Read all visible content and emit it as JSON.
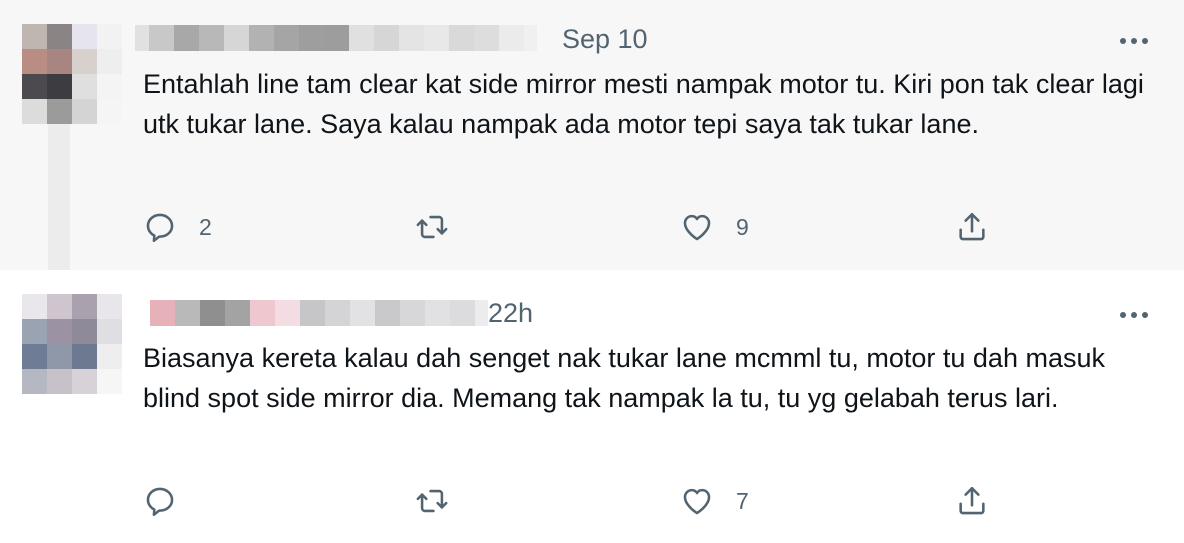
{
  "tweets": [
    {
      "time": "Sep 10",
      "text": "Entahlah line tam clear kat side mirror mesti nampak motor tu. Kiri pon tak clear lagi utk tukar lane. Saya kalau nampak ada motor tepi saya tak tukar lane.",
      "reply_count": "2",
      "retweet_count": "",
      "like_count": "9"
    },
    {
      "time": "22h",
      "text": "Biasanya kereta kalau dah senget nak tukar lane mcmml tu, motor tu dah masuk blind spot side mirror dia. Memang tak nampak la tu, tu yg gelabah terus lari.",
      "reply_count": "",
      "retweet_count": "",
      "like_count": "7"
    }
  ],
  "icons": {
    "more": "more-horizontal-icon",
    "reply": "reply-icon",
    "retweet": "retweet-icon",
    "like": "heart-icon",
    "share": "share-icon"
  },
  "colors": {
    "icon_gray": "#536471",
    "text": "#0f1419",
    "tweet1_bg": "#f7f7f7"
  }
}
